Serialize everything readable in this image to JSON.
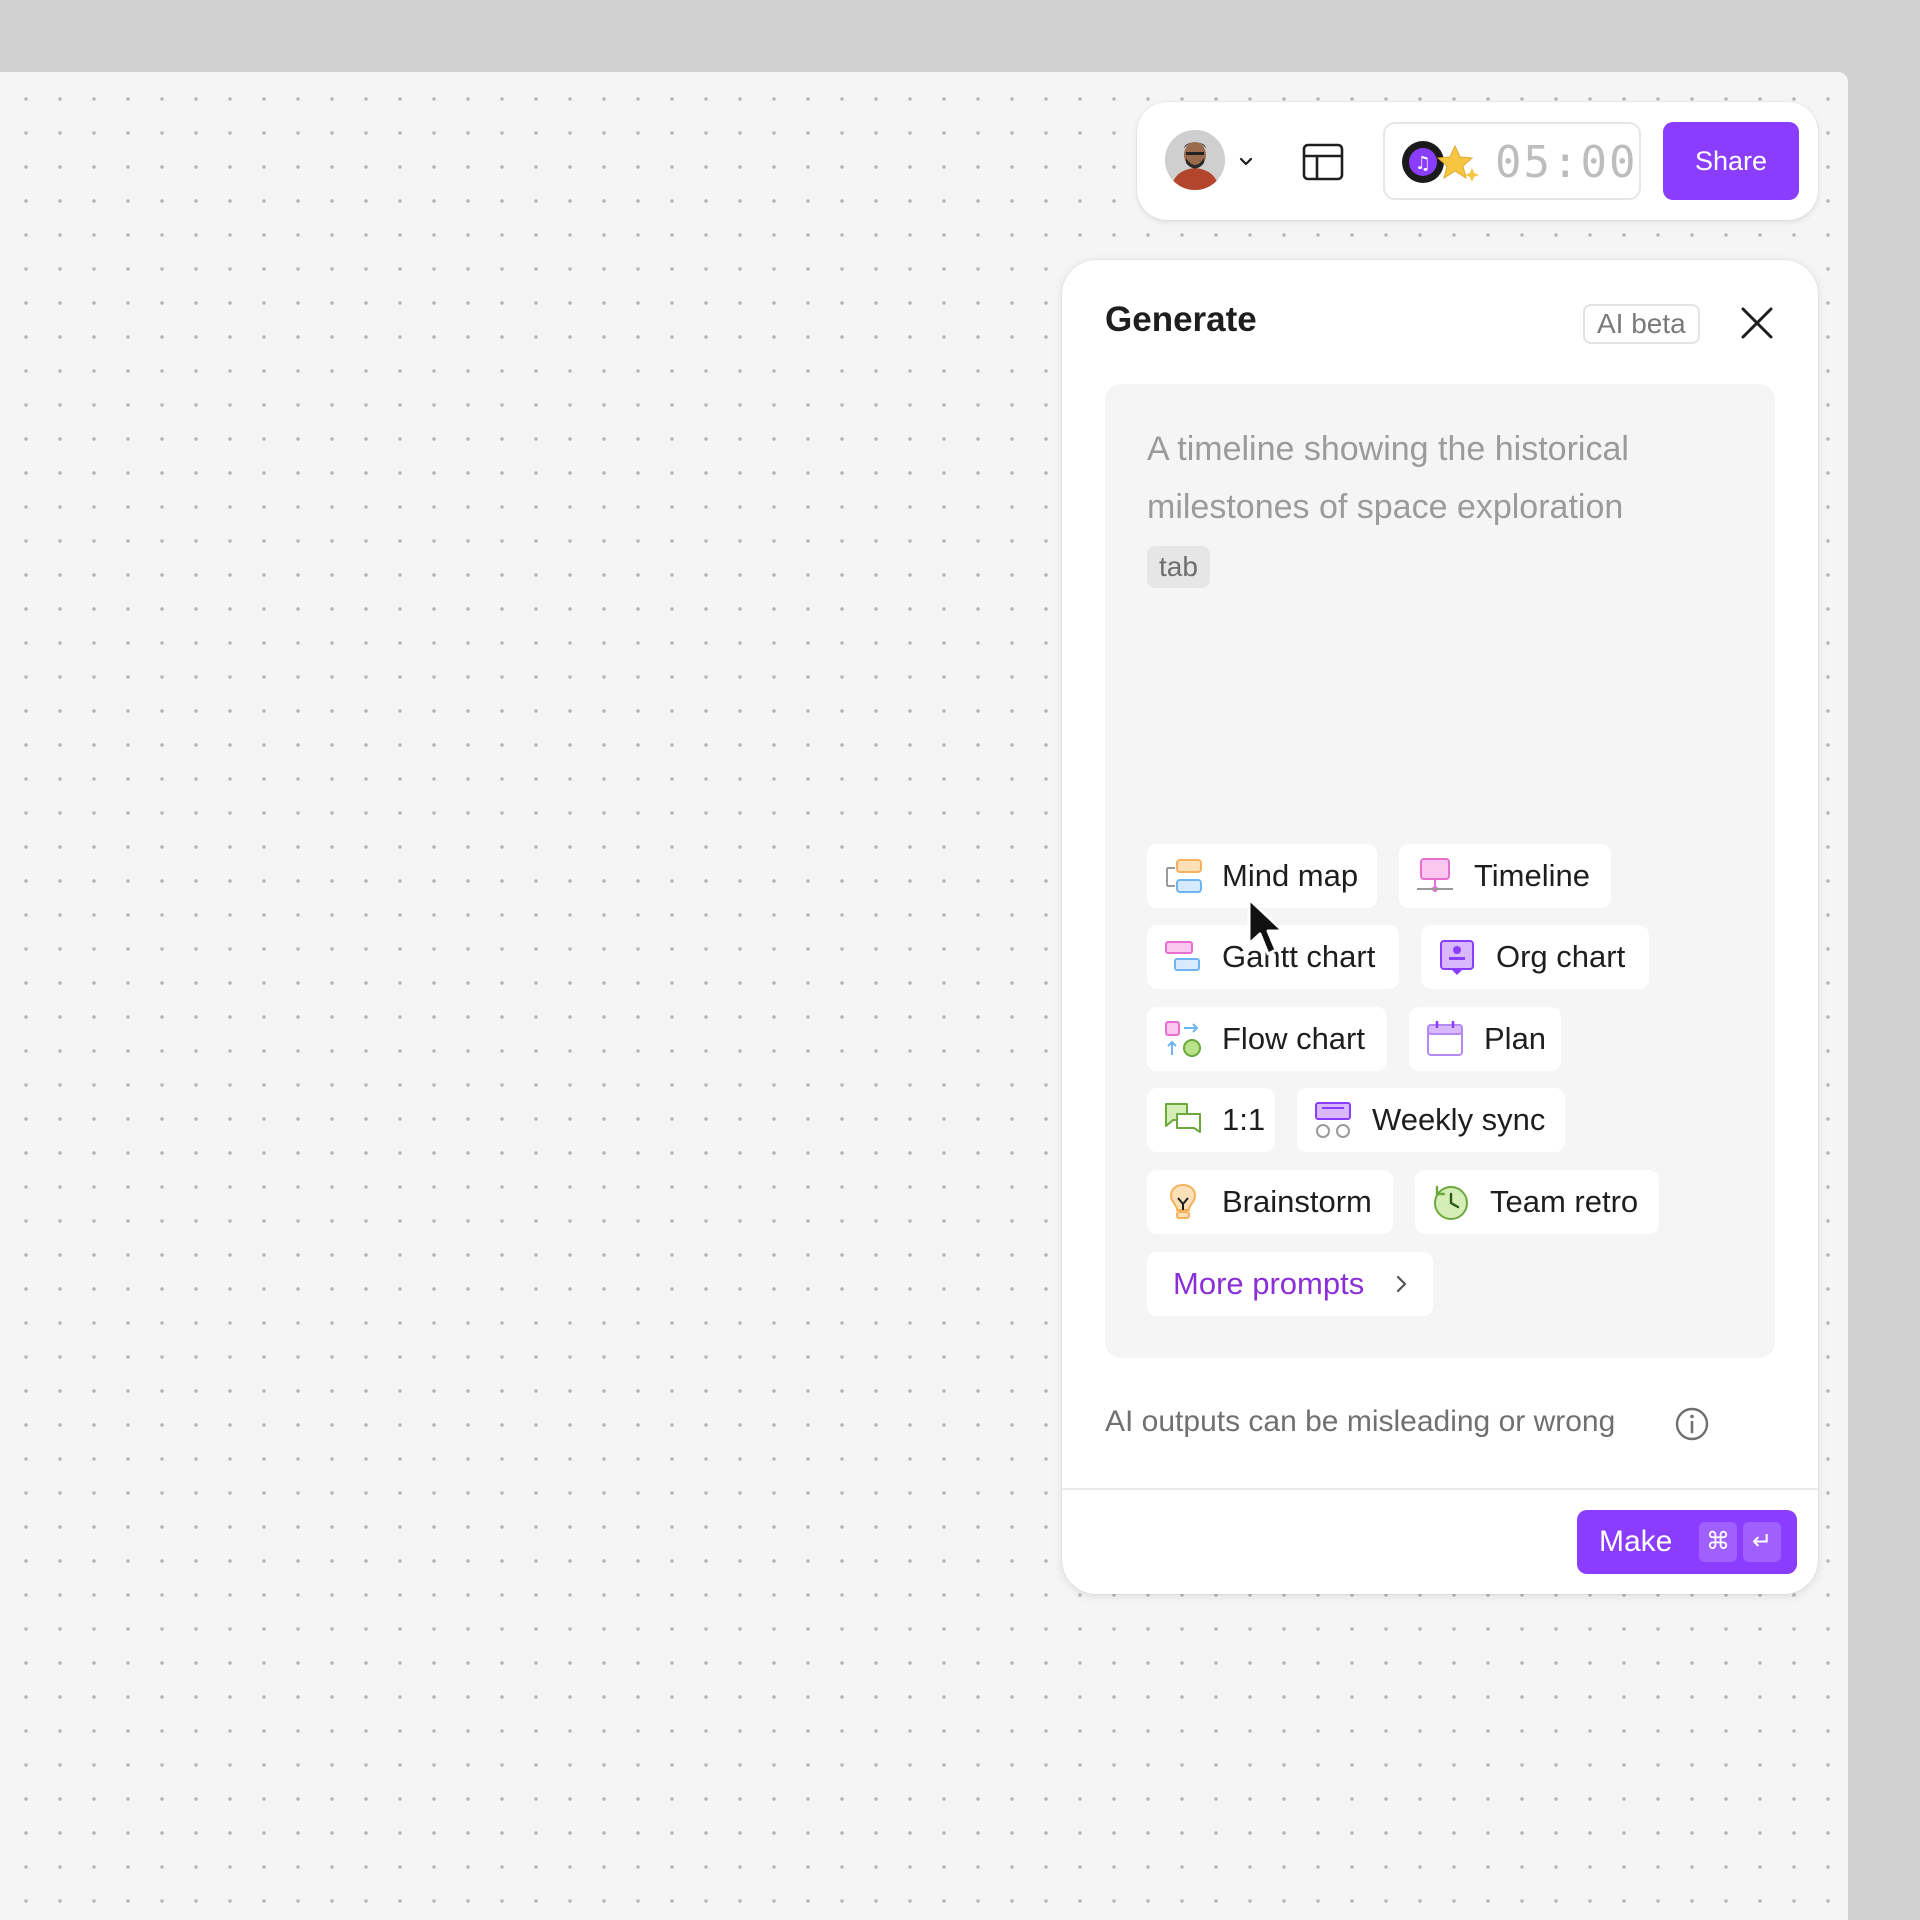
{
  "toolbar": {
    "timer": "05:00",
    "share_label": "Share",
    "icons": [
      "avatar",
      "chevron-down-icon",
      "layout-icon",
      "music-disc-icon",
      "star-sparkle-icon"
    ]
  },
  "panel": {
    "title": "Generate",
    "badge": "AI beta",
    "prompt_placeholder": "A timeline showing the historical milestones of space exploration",
    "tab_hint": "tab",
    "chips": [
      {
        "label": "Mind map",
        "icon": "mind-map-icon"
      },
      {
        "label": "Timeline",
        "icon": "timeline-icon"
      },
      {
        "label": "Gantt chart",
        "icon": "gantt-chart-icon"
      },
      {
        "label": "Org chart",
        "icon": "org-chart-icon"
      },
      {
        "label": "Flow chart",
        "icon": "flow-chart-icon"
      },
      {
        "label": "Plan",
        "icon": "calendar-icon"
      },
      {
        "label": "1:1",
        "icon": "chat-bubbles-icon"
      },
      {
        "label": "Weekly sync",
        "icon": "weekly-sync-icon"
      },
      {
        "label": "Brainstorm",
        "icon": "lightbulb-icon"
      },
      {
        "label": "Team retro",
        "icon": "clock-icon"
      }
    ],
    "more_prompts_label": "More prompts",
    "disclaimer": "AI outputs can be misleading or wrong",
    "make_label": "Make",
    "shortcut_cmd": "⌘",
    "shortcut_enter": "↵"
  },
  "colors": {
    "accent": "#8b3dff",
    "link": "#8b30d9",
    "canvas": "#f5f5f5",
    "backdrop": "#d1d1d1"
  }
}
